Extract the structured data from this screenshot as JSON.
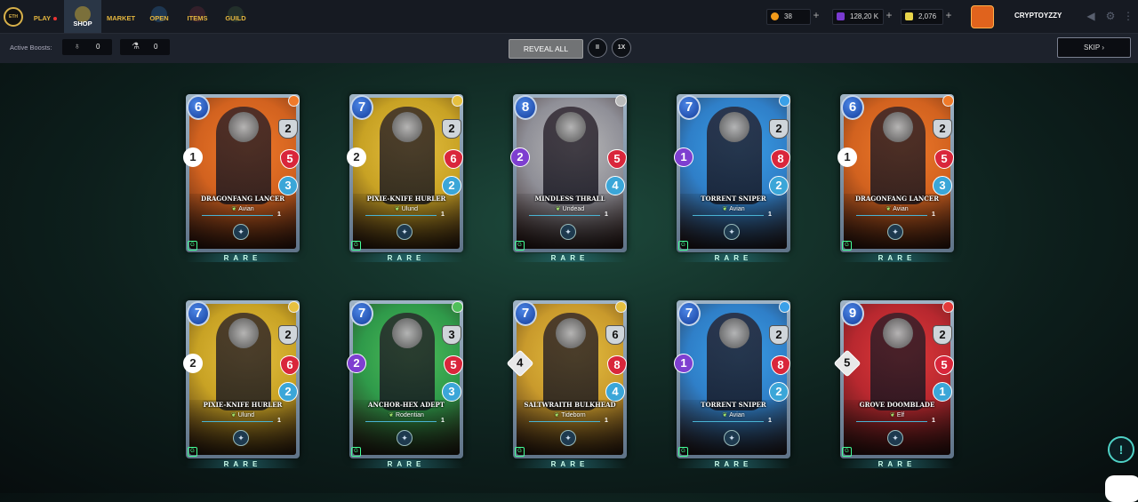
{
  "nav": {
    "logo": "ETH",
    "items": [
      {
        "label": "PLAY",
        "dot": true
      },
      {
        "label": "SHOP"
      },
      {
        "label": "MARKET"
      },
      {
        "label": "OPEN"
      },
      {
        "label": "ITEMS"
      },
      {
        "label": "GUILD"
      }
    ],
    "active": "SHOP"
  },
  "resources": {
    "gold": "38",
    "dark": "128,20 K",
    "energy": "2,076"
  },
  "user": {
    "name": "CRYPTOYZZY"
  },
  "boosts": {
    "label": "Active Boosts:",
    "potion_a": "0",
    "potion_b": "0"
  },
  "controls": {
    "reveal": "REVEAL ALL",
    "pause": "II",
    "speed": "1X",
    "skip": "SKIP"
  },
  "cards": [
    {
      "name": "DRAGONFANG LANCER",
      "type": "Avian",
      "mana": "6",
      "armor": "2",
      "hp": "5",
      "speed": "3",
      "attack": "1",
      "attack_kind": "melee",
      "level": "1",
      "rarity": "RARE",
      "element_color": "#f07a2a",
      "bg": "#d2621f"
    },
    {
      "name": "PIXIE-KNIFE HURLER",
      "type": "Ulund",
      "mana": "7",
      "armor": "2",
      "hp": "6",
      "speed": "2",
      "attack": "2",
      "attack_kind": "melee",
      "level": "1",
      "rarity": "RARE",
      "element_color": "#e6c040",
      "bg": "#c8a224"
    },
    {
      "name": "MINDLESS THRALL",
      "type": "Undead",
      "mana": "8",
      "armor": "",
      "hp": "5",
      "speed": "4",
      "attack": "2",
      "attack_kind": "magic",
      "level": "1",
      "rarity": "RARE",
      "element_color": "#bbbbbb",
      "bg": "#8f8f97"
    },
    {
      "name": "TORRENT SNIPER",
      "type": "Avian",
      "mana": "7",
      "armor": "2",
      "hp": "8",
      "speed": "2",
      "attack": "1",
      "attack_kind": "magic",
      "level": "1",
      "rarity": "RARE",
      "element_color": "#3aa0e8",
      "bg": "#2f7fc8"
    },
    {
      "name": "DRAGONFANG LANCER",
      "type": "Avian",
      "mana": "6",
      "armor": "2",
      "hp": "5",
      "speed": "3",
      "attack": "1",
      "attack_kind": "melee",
      "level": "1",
      "rarity": "RARE",
      "element_color": "#f07a2a",
      "bg": "#d2621f"
    },
    {
      "name": "PIXIE-KNIFE HURLER",
      "type": "Ulund",
      "mana": "7",
      "armor": "2",
      "hp": "6",
      "speed": "2",
      "attack": "2",
      "attack_kind": "melee",
      "level": "1",
      "rarity": "RARE",
      "element_color": "#e6c040",
      "bg": "#c8a224"
    },
    {
      "name": "ANCHOR-HEX ADEPT",
      "type": "Rodentian",
      "mana": "7",
      "armor": "3",
      "hp": "5",
      "speed": "3",
      "attack": "2",
      "attack_kind": "magic",
      "level": "1",
      "rarity": "RARE",
      "element_color": "#4fbf5a",
      "bg": "#2f9a4a"
    },
    {
      "name": "SALTWRAITH BULKHEAD",
      "type": "Tideborn",
      "mana": "7",
      "armor": "6",
      "hp": "8",
      "speed": "4",
      "attack": "4",
      "attack_kind": "ranged",
      "level": "1",
      "rarity": "RARE",
      "element_color": "#e6c040",
      "bg": "#c99a2c"
    },
    {
      "name": "TORRENT SNIPER",
      "type": "Avian",
      "mana": "7",
      "armor": "2",
      "hp": "8",
      "speed": "2",
      "attack": "1",
      "attack_kind": "magic",
      "level": "1",
      "rarity": "RARE",
      "element_color": "#3aa0e8",
      "bg": "#2f7fc8"
    },
    {
      "name": "GROVE DOOMBLADE",
      "type": "Elf",
      "mana": "9",
      "armor": "2",
      "hp": "5",
      "speed": "1",
      "attack": "5",
      "attack_kind": "ranged",
      "level": "1",
      "rarity": "RARE",
      "element_color": "#e23a3a",
      "bg": "#b8282f"
    }
  ]
}
